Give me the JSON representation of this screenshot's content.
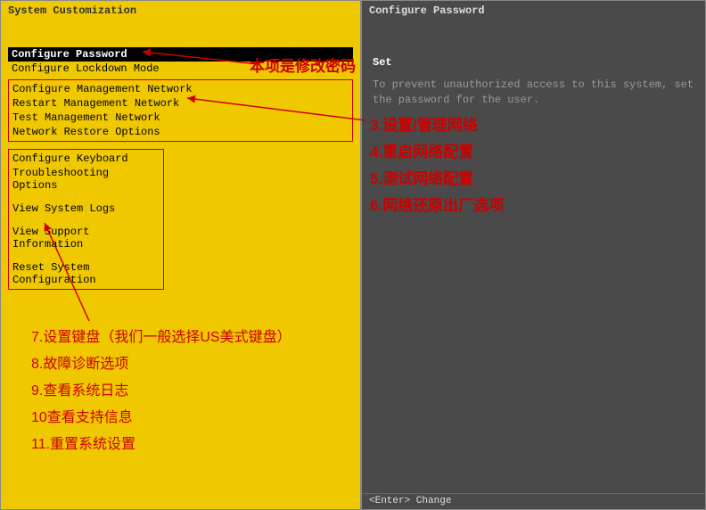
{
  "left": {
    "title": "System Customization",
    "menu_selected": "Configure Password",
    "menu_lockdown": "Configure Lockdown Mode",
    "box1": {
      "i1": "Configure Management Network",
      "i2": "Restart Management Network",
      "i3": "Test Management Network",
      "i4": "Network Restore Options"
    },
    "box2": {
      "i1": "Configure Keyboard",
      "i2": "Troubleshooting Options",
      "i3": "View System Logs",
      "i4": "View Support Information",
      "i5": "Reset System Configuration"
    }
  },
  "right": {
    "title": "Configure Password",
    "heading": "Set",
    "desc": "To prevent unauthorized access to this system, set the password for the user."
  },
  "footer": {
    "hint": "<Enter> Change"
  },
  "annotations": {
    "top": "本项是修改密码",
    "r3": "3.设置/管理网络",
    "r4": "4.重启网络配置",
    "r5": "5.测试网络配置",
    "r6": "6.网络还原出厂选项",
    "l7": "7.设置键盘（我们一般选择US美式键盘）",
    "l8": "8.故障诊断选项",
    "l9": "9.查看系统日志",
    "l10": "10查看支持信息",
    "l11": "11.重置系统设置"
  }
}
